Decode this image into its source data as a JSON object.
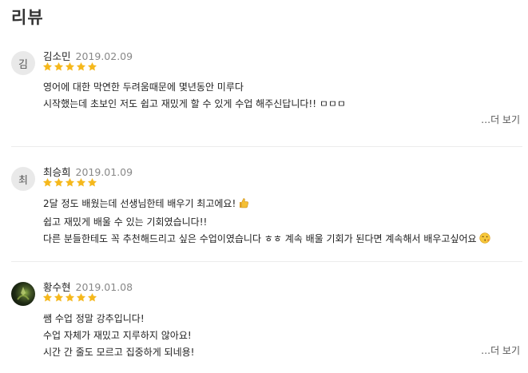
{
  "section": {
    "title": "리뷰"
  },
  "reviews": [
    {
      "avatar_text": "김",
      "author": "김소민",
      "date": "2019.02.09",
      "rating": 5,
      "lines": [
        "영어에 대한 막연한 두려움때문에 몇년동안 미루다",
        "시작했는데 초보인 저도 쉽고 재밌게 할 수 있게 수업 해주신답니다!! ㅁㅁㅁ"
      ],
      "more_label": "…더 보기"
    },
    {
      "avatar_text": "최",
      "author": "최승희",
      "date": "2019.01.09",
      "rating": 5,
      "lines": [
        "2달 정도 배웠는데 선생님한테 배우기 최고에요!",
        "쉽고 재밌게 배울 수 있는 기회였습니다!!",
        "다른 분들한테도 꼭 추천해드리고 싶은 수업이였습니다 ㅎㅎ 계속 배울 기회가 된다면 계속해서 배우고싶어요"
      ],
      "emoji_line1": "thumbs-up-icon",
      "emoji_line3": "kissing-face-icon"
    },
    {
      "avatar_text": "",
      "author": "황수현",
      "date": "2019.01.08",
      "rating": 5,
      "lines": [
        "쌤 수업 정말 강추입니다!",
        "수업 자체가 재밌고 지루하지 않아요!",
        "시간 간 줄도 모르고 집중하게 되네용!"
      ],
      "more_label": "…더 보기"
    }
  ],
  "colors": {
    "star": "#f5b81c",
    "divider": "#ececec"
  }
}
